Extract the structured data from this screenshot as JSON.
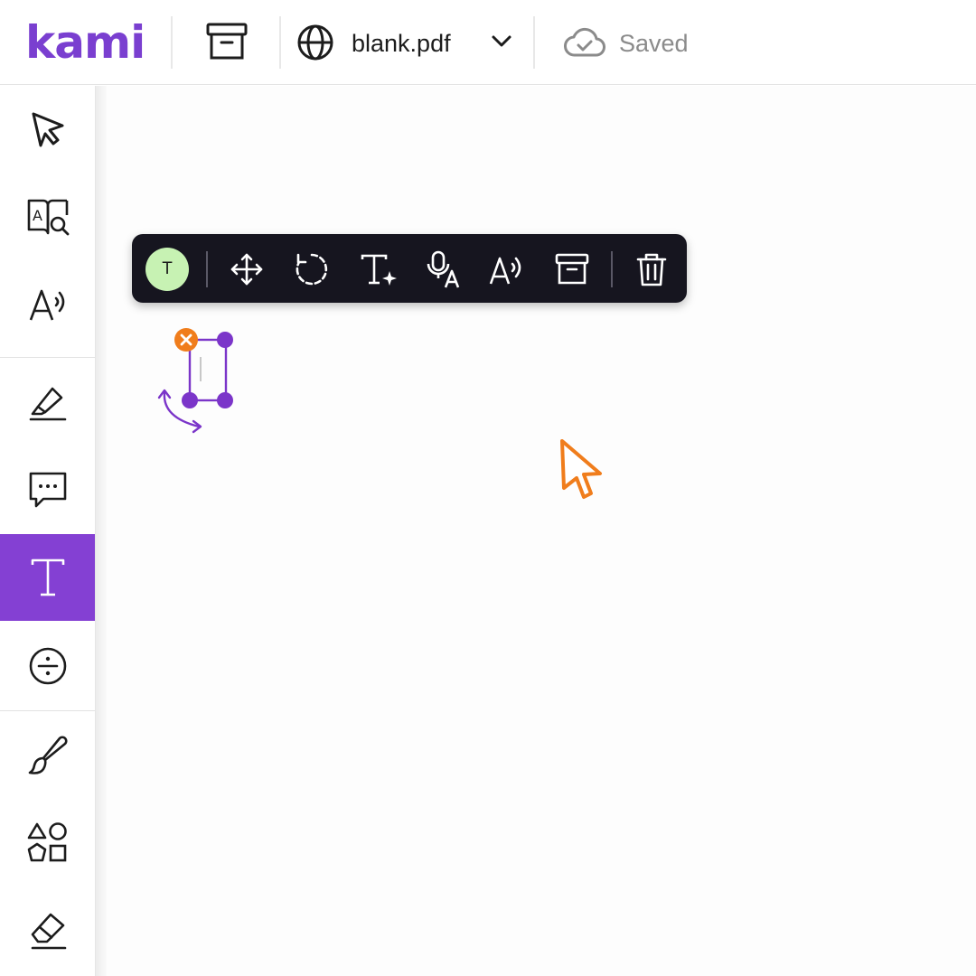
{
  "header": {
    "logo": "kami",
    "document_name": "blank.pdf",
    "save_status": "Saved",
    "icons": [
      "archive-icon",
      "globe-icon",
      "chevron-down-icon",
      "cloud-check-icon"
    ]
  },
  "sidebar": {
    "items": [
      {
        "name": "select",
        "icon": "pointer-icon"
      },
      {
        "name": "dictionary",
        "icon": "book-search-icon"
      },
      {
        "name": "read-aloud",
        "icon": "text-to-speech-icon"
      },
      {
        "name": "highlight",
        "icon": "highlighter-icon"
      },
      {
        "name": "comment",
        "icon": "comment-icon"
      },
      {
        "name": "text",
        "icon": "text-t-icon",
        "active": true
      },
      {
        "name": "equation",
        "icon": "divide-icon"
      },
      {
        "name": "drawing",
        "icon": "brush-icon"
      },
      {
        "name": "shapes",
        "icon": "shapes-icon"
      },
      {
        "name": "eraser",
        "icon": "eraser-icon"
      }
    ]
  },
  "annotation_toolbar": {
    "avatar_initial": "T",
    "tools": [
      "move-icon",
      "rotate-icon",
      "text-style-icon",
      "voice-typing-icon",
      "read-aloud-icon",
      "archive-icon",
      "trash-icon"
    ]
  },
  "colors": {
    "brand": "#7a3fd0",
    "active_tool": "#8440d3",
    "toolbar_bg": "#16151f",
    "avatar_bg": "#c7f2b3",
    "handle": "#7b35c9",
    "delete_handle": "#f07d1c",
    "cursor": "#f07d1c",
    "saved_text": "#8b8b8b"
  }
}
